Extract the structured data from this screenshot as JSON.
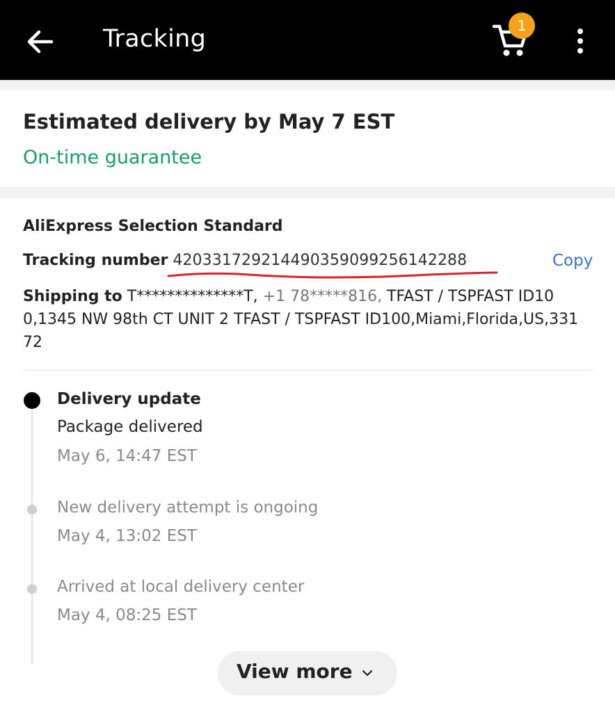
{
  "header": {
    "title": "Tracking",
    "back_icon": "arrow-left-icon",
    "cart_icon": "cart-icon",
    "cart_count": "1",
    "more_icon": "more-vertical-icon",
    "badge_color": "#f7a21b"
  },
  "delivery": {
    "estimate": "Estimated delivery by May 7 EST",
    "guarantee": "On-time guarantee",
    "guarantee_color": "#1b9a6d"
  },
  "shipment": {
    "carrier": "AliExpress Selection Standard",
    "tracking_label": "Tracking number",
    "tracking_number": "420331729214490359099256142288",
    "copy_label": "Copy",
    "copy_color": "#3a74c4",
    "shipping_label": "Shipping to",
    "recipient": "T**************T,",
    "phone": "+1 78*****816,",
    "address_line1": "TFAST / TSPFAST ID10",
    "address_line2": "0,1345 NW 98th CT UNIT 2 TFAST / TSPFAST ID100,Miami,Florida,US,331",
    "address_line3": "72"
  },
  "timeline": [
    {
      "title": "Delivery update",
      "text": "Package delivered",
      "time": "May 6, 14:47 EST"
    },
    {
      "text": "New delivery attempt is ongoing",
      "time": "May 4, 13:02 EST"
    },
    {
      "text": "Arrived at local delivery center",
      "time": "May 4, 08:25 EST"
    }
  ],
  "view_more": {
    "label": "View more",
    "icon": "chevron-down-icon"
  }
}
